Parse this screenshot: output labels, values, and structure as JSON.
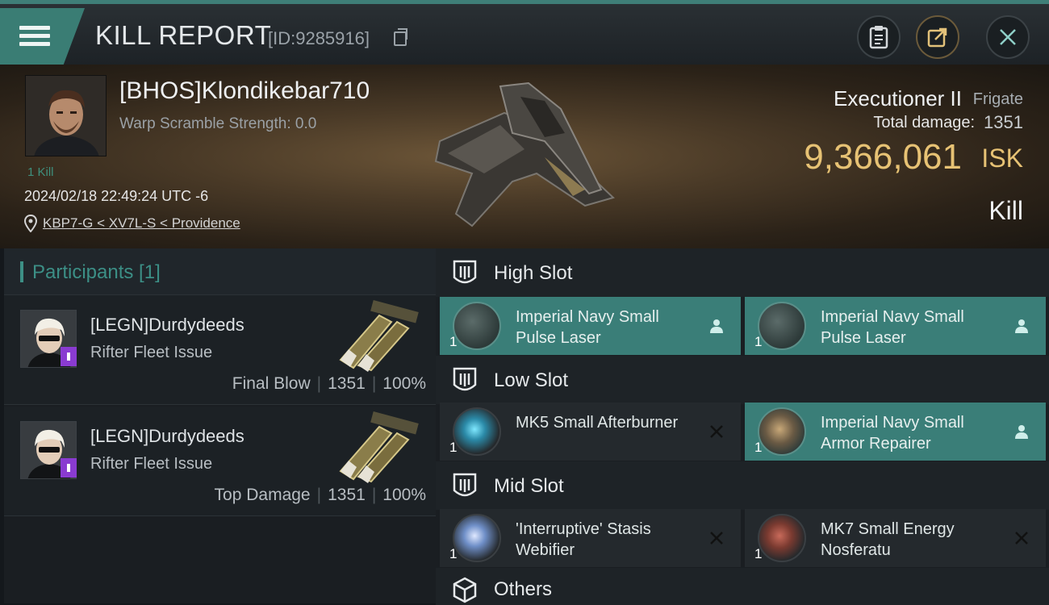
{
  "header": {
    "title": "KILL REPORT",
    "report_id": "[ID:9285916]"
  },
  "victim": {
    "name": "[BHOS]Klondikebar710",
    "warp_scramble": "Warp Scramble Strength: 0.0",
    "kills_badge": "1 Kill",
    "datetime": "2024/02/18 22:49:24 UTC -6",
    "location": "KBP7-G < XV7L-S < Providence",
    "ship_name": "Executioner II",
    "ship_class": "Frigate",
    "total_damage_label": "Total damage:",
    "total_damage": "1351",
    "isk_value": "9,366,061",
    "isk_unit": "ISK",
    "result": "Kill"
  },
  "participants": {
    "title": "Participants [1]",
    "rows": [
      {
        "name": "[LEGN]Durdydeeds",
        "ship": "Rifter Fleet Issue",
        "role": "Final Blow",
        "damage": "1351",
        "percent": "100%"
      },
      {
        "name": "[LEGN]Durdydeeds",
        "ship": "Rifter Fleet Issue",
        "role": "Top Damage",
        "damage": "1351",
        "percent": "100%"
      }
    ]
  },
  "slots": {
    "high": {
      "title": "High Slot",
      "modules": [
        {
          "name": "Imperial Navy Small Pulse Laser",
          "qty": "1",
          "status": "fitted"
        },
        {
          "name": "Imperial Navy Small Pulse Laser",
          "qty": "1",
          "status": "fitted"
        }
      ]
    },
    "low": {
      "title": "Low Slot",
      "modules": [
        {
          "name": "MK5 Small Afterburner",
          "qty": "1",
          "status": "destroyed"
        },
        {
          "name": "Imperial Navy Small Armor Repairer",
          "qty": "1",
          "status": "fitted"
        }
      ]
    },
    "mid": {
      "title": "Mid Slot",
      "modules": [
        {
          "name": "'Interruptive' Stasis Webifier",
          "qty": "1",
          "status": "destroyed"
        },
        {
          "name": "MK7 Small Energy Nosferatu",
          "qty": "1",
          "status": "destroyed"
        }
      ]
    },
    "others": {
      "title": "Others"
    }
  },
  "colors": {
    "accent": "#3a7e78",
    "isk": "#e7c274",
    "participants_title": "#3c8f86"
  },
  "icons": [
    "menu-icon",
    "copy-icon",
    "clipboard-icon",
    "share-icon",
    "close-icon",
    "location-pin-icon",
    "fitted-person-icon",
    "destroyed-x-icon",
    "slot-icon",
    "cube-icon"
  ]
}
